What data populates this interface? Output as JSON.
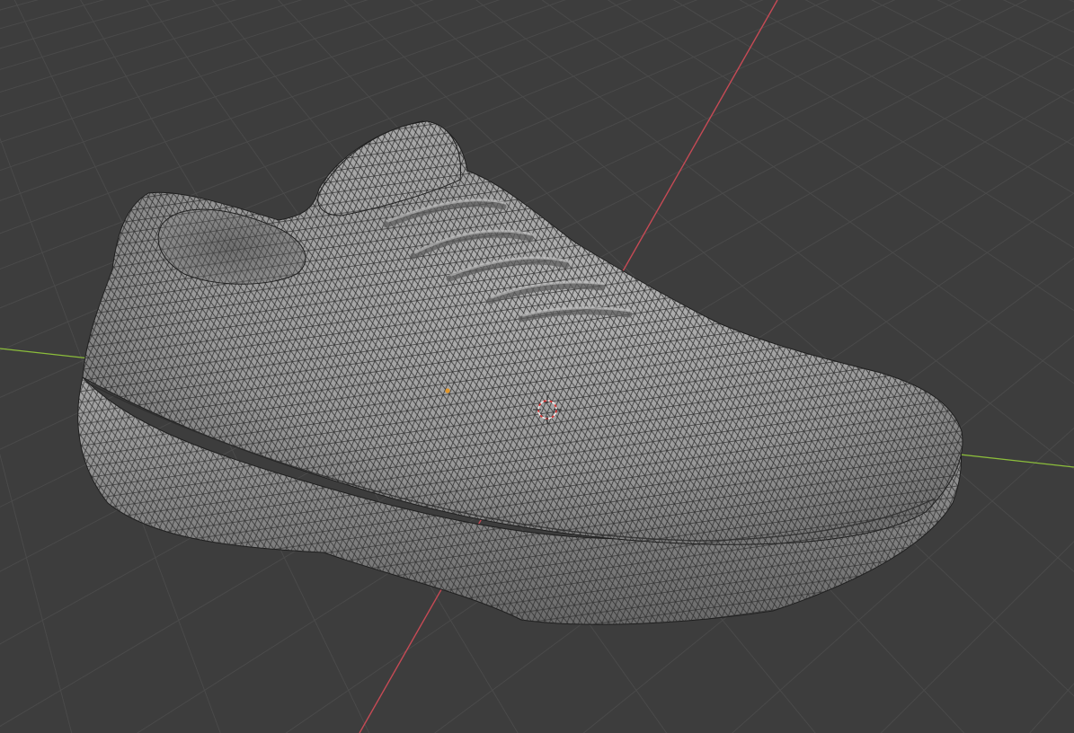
{
  "viewport": {
    "mode": "3D Viewport",
    "background_color": "#3d3d3d",
    "grid_color": "#4a4a4a",
    "x_axis_color": "#c64a55",
    "y_axis_color": "#8cbe3b"
  },
  "object": {
    "name": "shoe-mesh",
    "display": "wireframe-overlay",
    "surface_color": "#9a9a9a",
    "wire_color": "#202020"
  },
  "overlays": {
    "origin_icon": "object-origin-dot",
    "cursor_icon": "3d-cursor",
    "origin_color": "#e0952a",
    "cursor_color": "#e03030"
  }
}
